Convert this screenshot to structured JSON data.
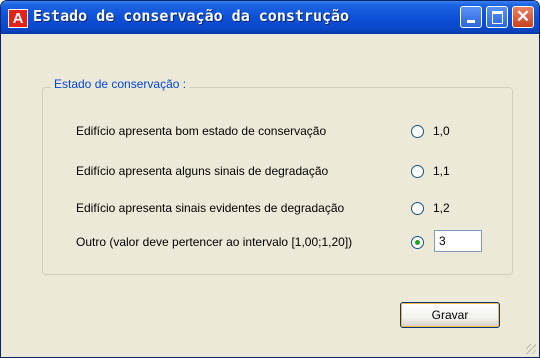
{
  "window": {
    "title": "Estado de conservação da construção",
    "icon_name": "app-logo-icon",
    "icon_letter": "A"
  },
  "group": {
    "label": "Estado de conservação :"
  },
  "options": [
    {
      "label": "Edifício apresenta bom estado de conservação",
      "value": "1,0",
      "checked": false
    },
    {
      "label": "Edifício apresenta alguns sinais de degradação",
      "value": "1,1",
      "checked": false
    },
    {
      "label": "Edifício apresenta sinais evidentes de degradação",
      "value": "1,2",
      "checked": false
    },
    {
      "label": "Outro (valor deve pertencer ao intervalo [1,00;1,20])",
      "value": "",
      "checked": true
    }
  ],
  "other_input": {
    "value": "3"
  },
  "buttons": {
    "save_label": "Gravar"
  },
  "colors": {
    "titlebar": "#0a47c7",
    "group_label": "#0046d5",
    "dialog_bg": "#ece9d8"
  }
}
